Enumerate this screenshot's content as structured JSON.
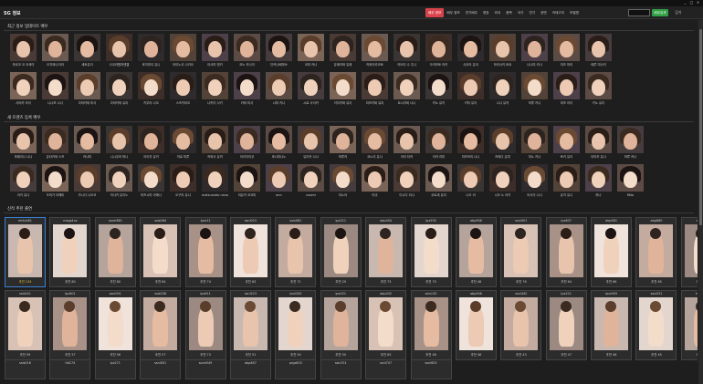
{
  "window": {
    "title": "SG 정보",
    "controls": [
      "_",
      "□",
      "×"
    ]
  },
  "nav": {
    "tabs": [
      {
        "label": "배우 정보",
        "active": true
      },
      {
        "label": "배우 정보",
        "active": false
      },
      {
        "label": "연기배우",
        "active": false
      },
      {
        "label": "명장",
        "active": false
      },
      {
        "label": "외국",
        "active": false
      },
      {
        "label": "품목",
        "active": false
      },
      {
        "label": "국가",
        "active": false
      },
      {
        "label": "연기",
        "active": false
      },
      {
        "label": "장면",
        "active": false
      },
      {
        "label": "카테고리",
        "active": false
      },
      {
        "label": "모델명",
        "active": false
      }
    ],
    "search_value": "",
    "search_label": "배우검색",
    "close_label": "닫기"
  },
  "colors": {
    "accent": "#d9434b",
    "search": "#2fa043",
    "selected": "#3b7fd6",
    "highlight": "#e8c33a"
  },
  "sections": {
    "recent": {
      "title": "최근 정보 업데이트 배우"
    },
    "new": {
      "title": "새 프렌즈 등록 배우"
    },
    "release": {
      "title": "신작 추천 출연"
    }
  },
  "recent_rows": [
    [
      "하르코 코 코세이",
      "오자와나이라",
      "세토유이",
      "사쿠라원마엔젤",
      "후지미이 유나",
      "아이노쿠 나카오",
      "아사미 엔키",
      "코노 카나이",
      "단카나베마쓰",
      "코미 카나",
      "유메카와 유메",
      "카와이카코토",
      "카오리 나 주니",
      "오카모토 아키",
      "사쿠라 유아",
      "하라사키 바요",
      "나나미 카나",
      "미즈 마리",
      "테루 미사키"
    ],
    [
      "사야카 아이",
      "니나모 나나",
      "아마카와 미사",
      "아마카와 유리",
      "키무라 나오",
      "스즈키리오",
      "나카이 사키",
      "카와 미사",
      "나미 키나",
      "시로 사이카",
      "이치카와 유이",
      "미즈카와 유리",
      "요시자와 나나",
      "카노 유키",
      "키타 유이",
      "니나 유카",
      "하루 키나",
      "미즈 아이",
      "키노 유이"
    ]
  ],
  "new_rows": [
    [
      "하레이나 나나",
      "유타카와 스즈",
      "카나미",
      "니시무라 마나",
      "아이자 유키",
      "히로 미루",
      "카와사 유카",
      "아이자이쿠",
      "후나미나노",
      "유이카 나나",
      "하루카",
      "코노이 유나",
      "아이 타카",
      "아카 리미",
      "미즈모리 나나",
      "카와다 유미",
      "미노 키나",
      "토키 유이",
      "아리카 유나",
      "하루 카나"
    ],
    [
      "아키 유나",
      "오마가 아헤미",
      "카시다 나오코",
      "미사키 유이노",
      "미즈시마 아헤나",
      "오구라 유나",
      "matsumoto nana",
      "미유키 코코미",
      "ann",
      "naomi",
      "리노아",
      "미쿠",
      "이시다 리나",
      "쿠로세 유리",
      "나오 리",
      "나오 노 아키",
      "아사이 나나",
      "유키 유나",
      "하나",
      "Miko"
    ]
  ],
  "release_rows": [
    [
      {
        "code": "midv461",
        "rec": "추천 134",
        "selected": true
      },
      {
        "code": "mxgs4xx",
        "rec": "추천 80"
      },
      {
        "code": "sone380",
        "rec": "추천 80"
      },
      {
        "code": "ssis084",
        "rec": "추천 64"
      },
      {
        "code": "ipzz11",
        "rec": "추천 74"
      },
      {
        "code": "ssni015",
        "rec": "추천 63"
      },
      {
        "code": "ssis081",
        "rec": "추천 71"
      },
      {
        "code": "ipx311",
        "rec": "추천 29"
      },
      {
        "code": "abp404",
        "rec": "추천 73"
      },
      {
        "code": "ipx535",
        "rec": "추천 70"
      },
      {
        "code": "abp906",
        "rec": "추천 48"
      },
      {
        "code": "ssni001",
        "rec": "추천 76"
      },
      {
        "code": "ipx637",
        "rec": "추천 64"
      },
      {
        "code": "abp581",
        "rec": "추천 66"
      },
      {
        "code": "abp860",
        "rec": "추천 65"
      },
      {
        "code": "ipx933",
        "rec": "추천 61"
      }
    ],
    [
      {
        "code": "ssis541",
        "rec": "추천 59"
      },
      {
        "code": "ipx601",
        "rec": "추천 57"
      },
      {
        "code": "ssni001",
        "rec": "추천 56"
      },
      {
        "code": "ssis038",
        "rec": "추천 57"
      },
      {
        "code": "ipx611",
        "rec": "추천 73"
      },
      {
        "code": "ssni223",
        "rec": "추천 51"
      },
      {
        "code": "ssni345",
        "rec": "추천 54"
      },
      {
        "code": "ipx021",
        "rec": "추천 50"
      },
      {
        "code": "abp432",
        "rec": "추천 63"
      },
      {
        "code": "ssis130",
        "rec": "추천 48"
      },
      {
        "code": "abp508",
        "rec": "추천 48"
      },
      {
        "code": "ssni442",
        "rec": "추천 43"
      },
      {
        "code": "ipx221",
        "rec": "추천 47"
      },
      {
        "code": "ipzz005",
        "rec": "추천 46"
      },
      {
        "code": "ssis531",
        "rec": "추천 45"
      },
      {
        "code": "hpp104",
        "rec": "추천 44"
      }
    ],
    [
      {
        "code": "ssis016",
        "rec": ""
      },
      {
        "code": "tid174",
        "rec": ""
      },
      {
        "code": "ipz271",
        "rec": ""
      },
      {
        "code": "ssni001",
        "rec": ""
      },
      {
        "code": "sone549",
        "rec": ""
      },
      {
        "code": "abp487",
        "rec": ""
      },
      {
        "code": "prgz603",
        "rec": ""
      },
      {
        "code": "ssis701",
        "rec": ""
      },
      {
        "code": "ssni707",
        "rec": ""
      },
      {
        "code": "ssni603",
        "rec": ""
      }
    ]
  ]
}
